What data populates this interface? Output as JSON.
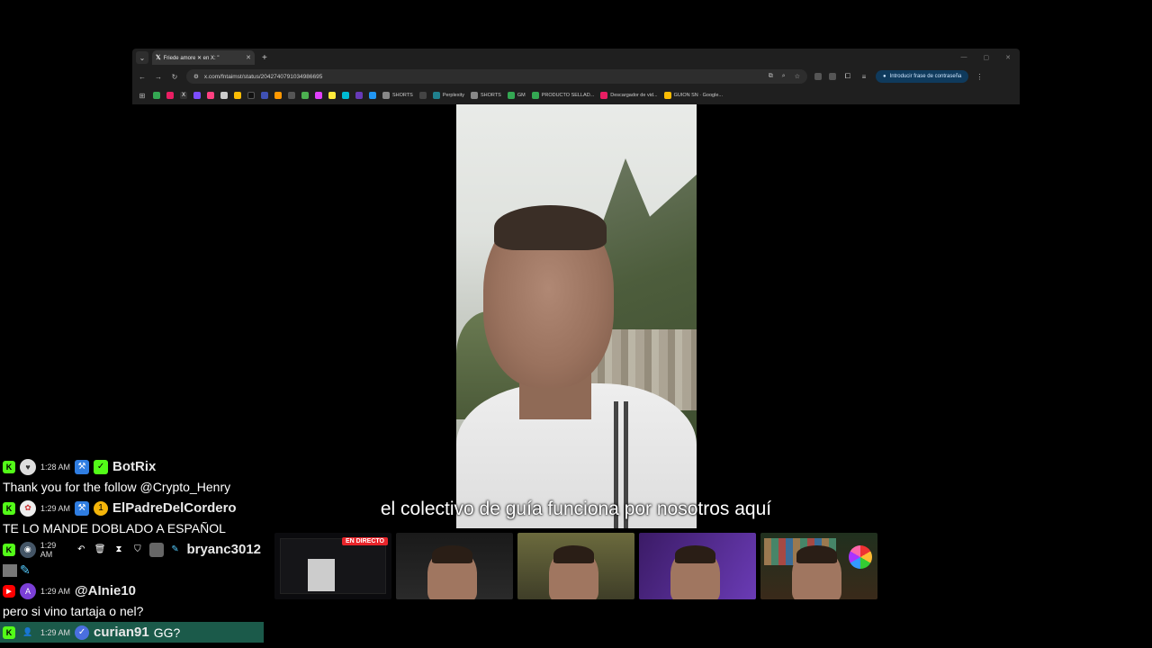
{
  "browser": {
    "tab_title": "Friede amore ✕ en X: \"",
    "url": "x.com/fntaimst/status/2042740791034986695",
    "password_button": "Introducir frase de contraseña",
    "bookmarks": [
      {
        "label": "SHORTS",
        "color": "#888888"
      },
      {
        "label": "Perplexity",
        "color": "#20808d"
      },
      {
        "label": "SHORTS",
        "color": "#888888"
      },
      {
        "label": "GM",
        "color": "#34a853"
      },
      {
        "label": "PRODUCTO SELLAD...",
        "color": "#34a853"
      },
      {
        "label": "Descargador de vid...",
        "color": "#e91e63"
      },
      {
        "label": "GUION SN · Google...",
        "color": "#fbbc04"
      }
    ]
  },
  "video": {
    "subtitle": "el colectivo de guía funciona por nosotros aquí"
  },
  "chat": {
    "messages": [
      {
        "platform": "kick",
        "time": "1:28 AM",
        "user": "BotRix",
        "text": "Thank you for the follow @Crypto_Henry"
      },
      {
        "platform": "kick",
        "time": "1:29 AM",
        "user": "ElPadreDelCordero",
        "text": "TE LO MANDE DOBLADO A ESPAÑOL"
      },
      {
        "platform": "kick",
        "time": "1:29 AM",
        "user": "bryanc3012",
        "text": ""
      },
      {
        "platform": "youtube",
        "time": "1:29 AM",
        "avatar_letter": "A",
        "user": "@AInie10",
        "text": "pero si vino tartaja o nel?"
      },
      {
        "platform": "kick",
        "time": "1:29 AM",
        "user": "curian91",
        "text": "GG?"
      }
    ]
  },
  "cams": {
    "live_label": "EN DIRECTO"
  },
  "colors": {
    "kick_green": "#53fc18",
    "youtube_red": "#ff0000",
    "live_red": "#e8252b",
    "highlight": "#1b5a4a"
  }
}
